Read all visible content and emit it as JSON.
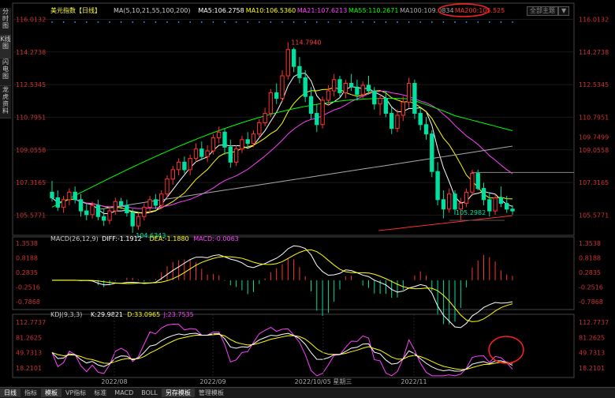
{
  "tool_tabs": [
    "分时图",
    "K线图",
    "闪电图",
    "龙虎资料"
  ],
  "top_buttons": [
    "全部主题",
    "▼"
  ],
  "bottom_tabs": [
    "日线",
    "指标",
    "模板",
    "VP指标",
    "标准",
    "MACD",
    "BOLL",
    "另存模板",
    "管理模板"
  ],
  "main_panel": {
    "title": "美元指数【日线】",
    "legend": [
      {
        "text": "MA(5,10,21,55,100,200)",
        "color": "#cccccc"
      },
      {
        "text": "MA5:106.2758",
        "color": "#ffffff"
      },
      {
        "text": "MA10:106.5360",
        "color": "#ffff00"
      },
      {
        "text": "MA21:107.6213",
        "color": "#ff40ff"
      },
      {
        "text": "MA55:110.2671",
        "color": "#00ff00"
      },
      {
        "text": "MA100:109.0834",
        "color": "#aaaaaa"
      },
      {
        "text": "MA200:105.525",
        "color": "#ff3030"
      }
    ],
    "y_ticks": [
      "116.0132",
      "114.2738",
      "112.5345",
      "110.7951",
      "109.0558",
      "107.3165",
      "105.5771"
    ],
    "right_extra_label": "109.7499",
    "high_label": "114.7940",
    "low_label1": "104.6343",
    "low_label2": "105.2982"
  },
  "macd_panel": {
    "legend": [
      {
        "text": "MACD(26,12,9)",
        "color": "#cccccc"
      },
      {
        "text": "DIFF:-1.1912",
        "color": "#ffffff"
      },
      {
        "text": "DEA:-1.1880",
        "color": "#ffff00"
      },
      {
        "text": "MACD:-0.0063",
        "color": "#ff40ff"
      }
    ],
    "y_ticks": [
      "1.3538",
      "0.8188",
      "0.2835",
      "-0.2516",
      "-0.7868"
    ]
  },
  "kdj_panel": {
    "legend": [
      {
        "text": "KDJ(9,3,3)",
        "color": "#cccccc"
      },
      {
        "text": "K:29.9821",
        "color": "#ffffff"
      },
      {
        "text": "D:33.0965",
        "color": "#ffff00"
      },
      {
        "text": "J:23.7535",
        "color": "#ff40ff"
      }
    ],
    "y_ticks": [
      "112.7737",
      "81.2625",
      "49.7313",
      "18.2101"
    ]
  },
  "x_labels": [
    "2022/08",
    "2022/09",
    "2022/10/05 星期三",
    "2022/11"
  ],
  "colors": {
    "up": "#ff3232",
    "down": "#00e0a0",
    "ma5": "#ffffff",
    "ma10": "#ffff00",
    "ma21": "#ff40ff",
    "ma55": "#00ff00",
    "ma100": "#aaaaaa",
    "ma200": "#ff3030",
    "annot": "#ff2020"
  },
  "chart_data": {
    "type": "candlestick",
    "y_range": [
      104.5,
      116.2
    ],
    "dates_note": "",
    "candles": [
      {
        "o": 106.8,
        "h": 107.4,
        "l": 106.3,
        "c": 106.5
      },
      {
        "o": 106.5,
        "h": 106.9,
        "l": 105.8,
        "c": 106.0
      },
      {
        "o": 106.0,
        "h": 106.6,
        "l": 105.7,
        "c": 106.4
      },
      {
        "o": 106.4,
        "h": 107.0,
        "l": 106.1,
        "c": 106.8
      },
      {
        "o": 106.8,
        "h": 107.1,
        "l": 106.2,
        "c": 106.4
      },
      {
        "o": 106.4,
        "h": 106.7,
        "l": 105.5,
        "c": 105.8
      },
      {
        "o": 105.8,
        "h": 106.2,
        "l": 105.3,
        "c": 105.6
      },
      {
        "o": 105.6,
        "h": 106.3,
        "l": 105.4,
        "c": 106.1
      },
      {
        "o": 106.1,
        "h": 106.4,
        "l": 105.3,
        "c": 105.5
      },
      {
        "o": 105.5,
        "h": 105.9,
        "l": 105.0,
        "c": 105.3
      },
      {
        "o": 105.3,
        "h": 106.0,
        "l": 105.1,
        "c": 105.8
      },
      {
        "o": 105.8,
        "h": 106.5,
        "l": 105.6,
        "c": 106.3
      },
      {
        "o": 106.3,
        "h": 106.5,
        "l": 105.9,
        "c": 106.1
      },
      {
        "o": 106.1,
        "h": 106.4,
        "l": 105.5,
        "c": 105.7
      },
      {
        "o": 105.7,
        "h": 105.9,
        "l": 104.63,
        "c": 105.0
      },
      {
        "o": 105.0,
        "h": 105.7,
        "l": 104.8,
        "c": 105.5
      },
      {
        "o": 105.5,
        "h": 106.2,
        "l": 105.3,
        "c": 106.0
      },
      {
        "o": 106.0,
        "h": 106.6,
        "l": 105.7,
        "c": 106.4
      },
      {
        "o": 106.4,
        "h": 106.7,
        "l": 105.9,
        "c": 106.1
      },
      {
        "o": 106.1,
        "h": 106.9,
        "l": 105.9,
        "c": 106.7
      },
      {
        "o": 106.7,
        "h": 107.7,
        "l": 106.5,
        "c": 107.5
      },
      {
        "o": 107.5,
        "h": 108.2,
        "l": 107.2,
        "c": 108.0
      },
      {
        "o": 108.0,
        "h": 108.6,
        "l": 107.7,
        "c": 108.4
      },
      {
        "o": 108.4,
        "h": 108.7,
        "l": 107.8,
        "c": 108.0
      },
      {
        "o": 108.0,
        "h": 108.8,
        "l": 107.7,
        "c": 108.6
      },
      {
        "o": 108.6,
        "h": 109.4,
        "l": 108.4,
        "c": 109.1
      },
      {
        "o": 109.1,
        "h": 109.5,
        "l": 108.5,
        "c": 108.7
      },
      {
        "o": 108.7,
        "h": 109.3,
        "l": 108.4,
        "c": 109.0
      },
      {
        "o": 109.0,
        "h": 109.9,
        "l": 108.8,
        "c": 109.7
      },
      {
        "o": 109.7,
        "h": 110.3,
        "l": 109.4,
        "c": 110.0
      },
      {
        "o": 110.0,
        "h": 110.2,
        "l": 108.8,
        "c": 109.2
      },
      {
        "o": 109.2,
        "h": 109.6,
        "l": 108.1,
        "c": 108.4
      },
      {
        "o": 108.4,
        "h": 109.3,
        "l": 108.2,
        "c": 109.1
      },
      {
        "o": 109.1,
        "h": 109.8,
        "l": 108.9,
        "c": 109.6
      },
      {
        "o": 109.6,
        "h": 110.0,
        "l": 109.2,
        "c": 109.4
      },
      {
        "o": 109.4,
        "h": 110.1,
        "l": 109.2,
        "c": 109.9
      },
      {
        "o": 109.9,
        "h": 110.7,
        "l": 109.7,
        "c": 110.5
      },
      {
        "o": 110.5,
        "h": 111.3,
        "l": 110.3,
        "c": 111.0
      },
      {
        "o": 111.0,
        "h": 112.3,
        "l": 110.8,
        "c": 112.1
      },
      {
        "o": 112.1,
        "h": 112.6,
        "l": 111.5,
        "c": 111.8
      },
      {
        "o": 111.8,
        "h": 113.3,
        "l": 111.6,
        "c": 113.0
      },
      {
        "o": 113.0,
        "h": 114.79,
        "l": 112.8,
        "c": 114.4
      },
      {
        "o": 114.4,
        "h": 114.5,
        "l": 113.2,
        "c": 113.5
      },
      {
        "o": 113.5,
        "h": 114.0,
        "l": 112.6,
        "c": 112.9
      },
      {
        "o": 112.9,
        "h": 113.3,
        "l": 111.6,
        "c": 111.9
      },
      {
        "o": 111.9,
        "h": 112.4,
        "l": 110.7,
        "c": 111.0
      },
      {
        "o": 111.0,
        "h": 111.5,
        "l": 110.0,
        "c": 110.4
      },
      {
        "o": 110.4,
        "h": 111.9,
        "l": 110.2,
        "c": 111.7
      },
      {
        "o": 111.7,
        "h": 112.5,
        "l": 111.4,
        "c": 112.2
      },
      {
        "o": 112.2,
        "h": 113.1,
        "l": 111.9,
        "c": 112.8
      },
      {
        "o": 112.8,
        "h": 113.0,
        "l": 111.9,
        "c": 112.1
      },
      {
        "o": 112.1,
        "h": 112.8,
        "l": 111.8,
        "c": 112.6
      },
      {
        "o": 112.6,
        "h": 113.1,
        "l": 112.2,
        "c": 112.4
      },
      {
        "o": 112.4,
        "h": 112.8,
        "l": 111.7,
        "c": 112.0
      },
      {
        "o": 112.0,
        "h": 112.7,
        "l": 111.8,
        "c": 112.5
      },
      {
        "o": 112.5,
        "h": 113.0,
        "l": 112.0,
        "c": 112.2
      },
      {
        "o": 112.2,
        "h": 112.4,
        "l": 111.2,
        "c": 111.5
      },
      {
        "o": 111.5,
        "h": 112.0,
        "l": 110.9,
        "c": 111.8
      },
      {
        "o": 111.8,
        "h": 112.2,
        "l": 110.8,
        "c": 111.0
      },
      {
        "o": 111.0,
        "h": 111.3,
        "l": 109.9,
        "c": 110.2
      },
      {
        "o": 110.2,
        "h": 111.2,
        "l": 110.0,
        "c": 110.9
      },
      {
        "o": 110.9,
        "h": 111.9,
        "l": 110.6,
        "c": 111.6
      },
      {
        "o": 111.6,
        "h": 112.9,
        "l": 111.3,
        "c": 112.6
      },
      {
        "o": 112.6,
        "h": 112.8,
        "l": 110.7,
        "c": 111.0
      },
      {
        "o": 111.0,
        "h": 111.3,
        "l": 110.1,
        "c": 110.4
      },
      {
        "o": 110.4,
        "h": 110.8,
        "l": 109.6,
        "c": 109.9
      },
      {
        "o": 109.9,
        "h": 110.1,
        "l": 107.6,
        "c": 107.9
      },
      {
        "o": 107.9,
        "h": 108.4,
        "l": 106.1,
        "c": 106.4
      },
      {
        "o": 106.4,
        "h": 106.9,
        "l": 105.4,
        "c": 105.9
      },
      {
        "o": 105.9,
        "h": 107.0,
        "l": 105.7,
        "c": 106.7
      },
      {
        "o": 106.7,
        "h": 106.9,
        "l": 105.6,
        "c": 105.9
      },
      {
        "o": 105.9,
        "h": 106.5,
        "l": 105.3,
        "c": 106.2
      },
      {
        "o": 106.2,
        "h": 107.0,
        "l": 106.0,
        "c": 106.8
      },
      {
        "o": 106.8,
        "h": 108.0,
        "l": 106.6,
        "c": 107.8
      },
      {
        "o": 107.8,
        "h": 108.0,
        "l": 106.9,
        "c": 107.0
      },
      {
        "o": 107.0,
        "h": 107.3,
        "l": 106.1,
        "c": 106.4
      },
      {
        "o": 106.4,
        "h": 106.8,
        "l": 105.5,
        "c": 105.8
      },
      {
        "o": 105.8,
        "h": 106.7,
        "l": 105.6,
        "c": 106.5
      },
      {
        "o": 106.5,
        "h": 107.1,
        "l": 106.0,
        "c": 106.2
      },
      {
        "o": 106.2,
        "h": 106.6,
        "l": 105.7,
        "c": 105.9
      },
      {
        "o": 105.9,
        "h": 106.1,
        "l": 105.6,
        "c": 105.8
      }
    ]
  }
}
